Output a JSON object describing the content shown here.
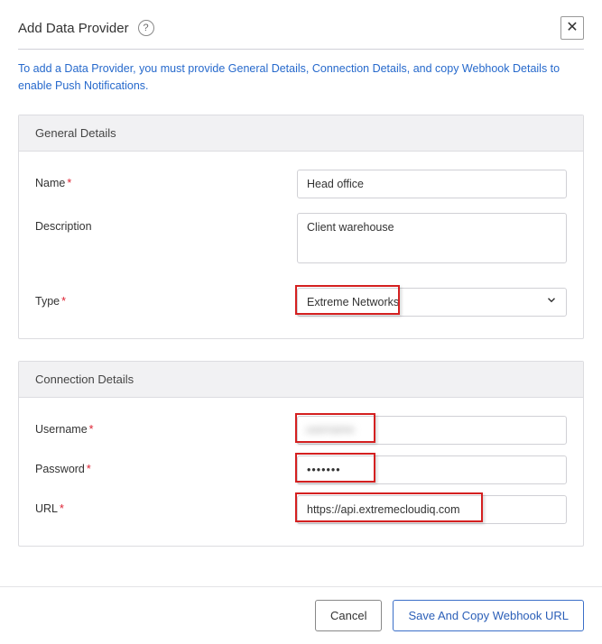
{
  "header": {
    "title": "Add Data Provider"
  },
  "info_text": "To add a Data Provider, you must provide General Details, Connection Details, and copy Webhook Details to enable Push Notifications.",
  "sections": {
    "general": {
      "title": "General Details",
      "name_label": "Name",
      "name_value": "Head office",
      "description_label": "Description",
      "description_value": "Client warehouse",
      "type_label": "Type",
      "type_value": "Extreme Networks"
    },
    "connection": {
      "title": "Connection Details",
      "username_label": "Username",
      "username_value": "username",
      "password_label": "Password",
      "password_value": "•••••••",
      "url_label": "URL",
      "url_value": "https://api.extremecloudiq.com"
    }
  },
  "footer": {
    "cancel": "Cancel",
    "save": "Save And Copy Webhook URL"
  }
}
